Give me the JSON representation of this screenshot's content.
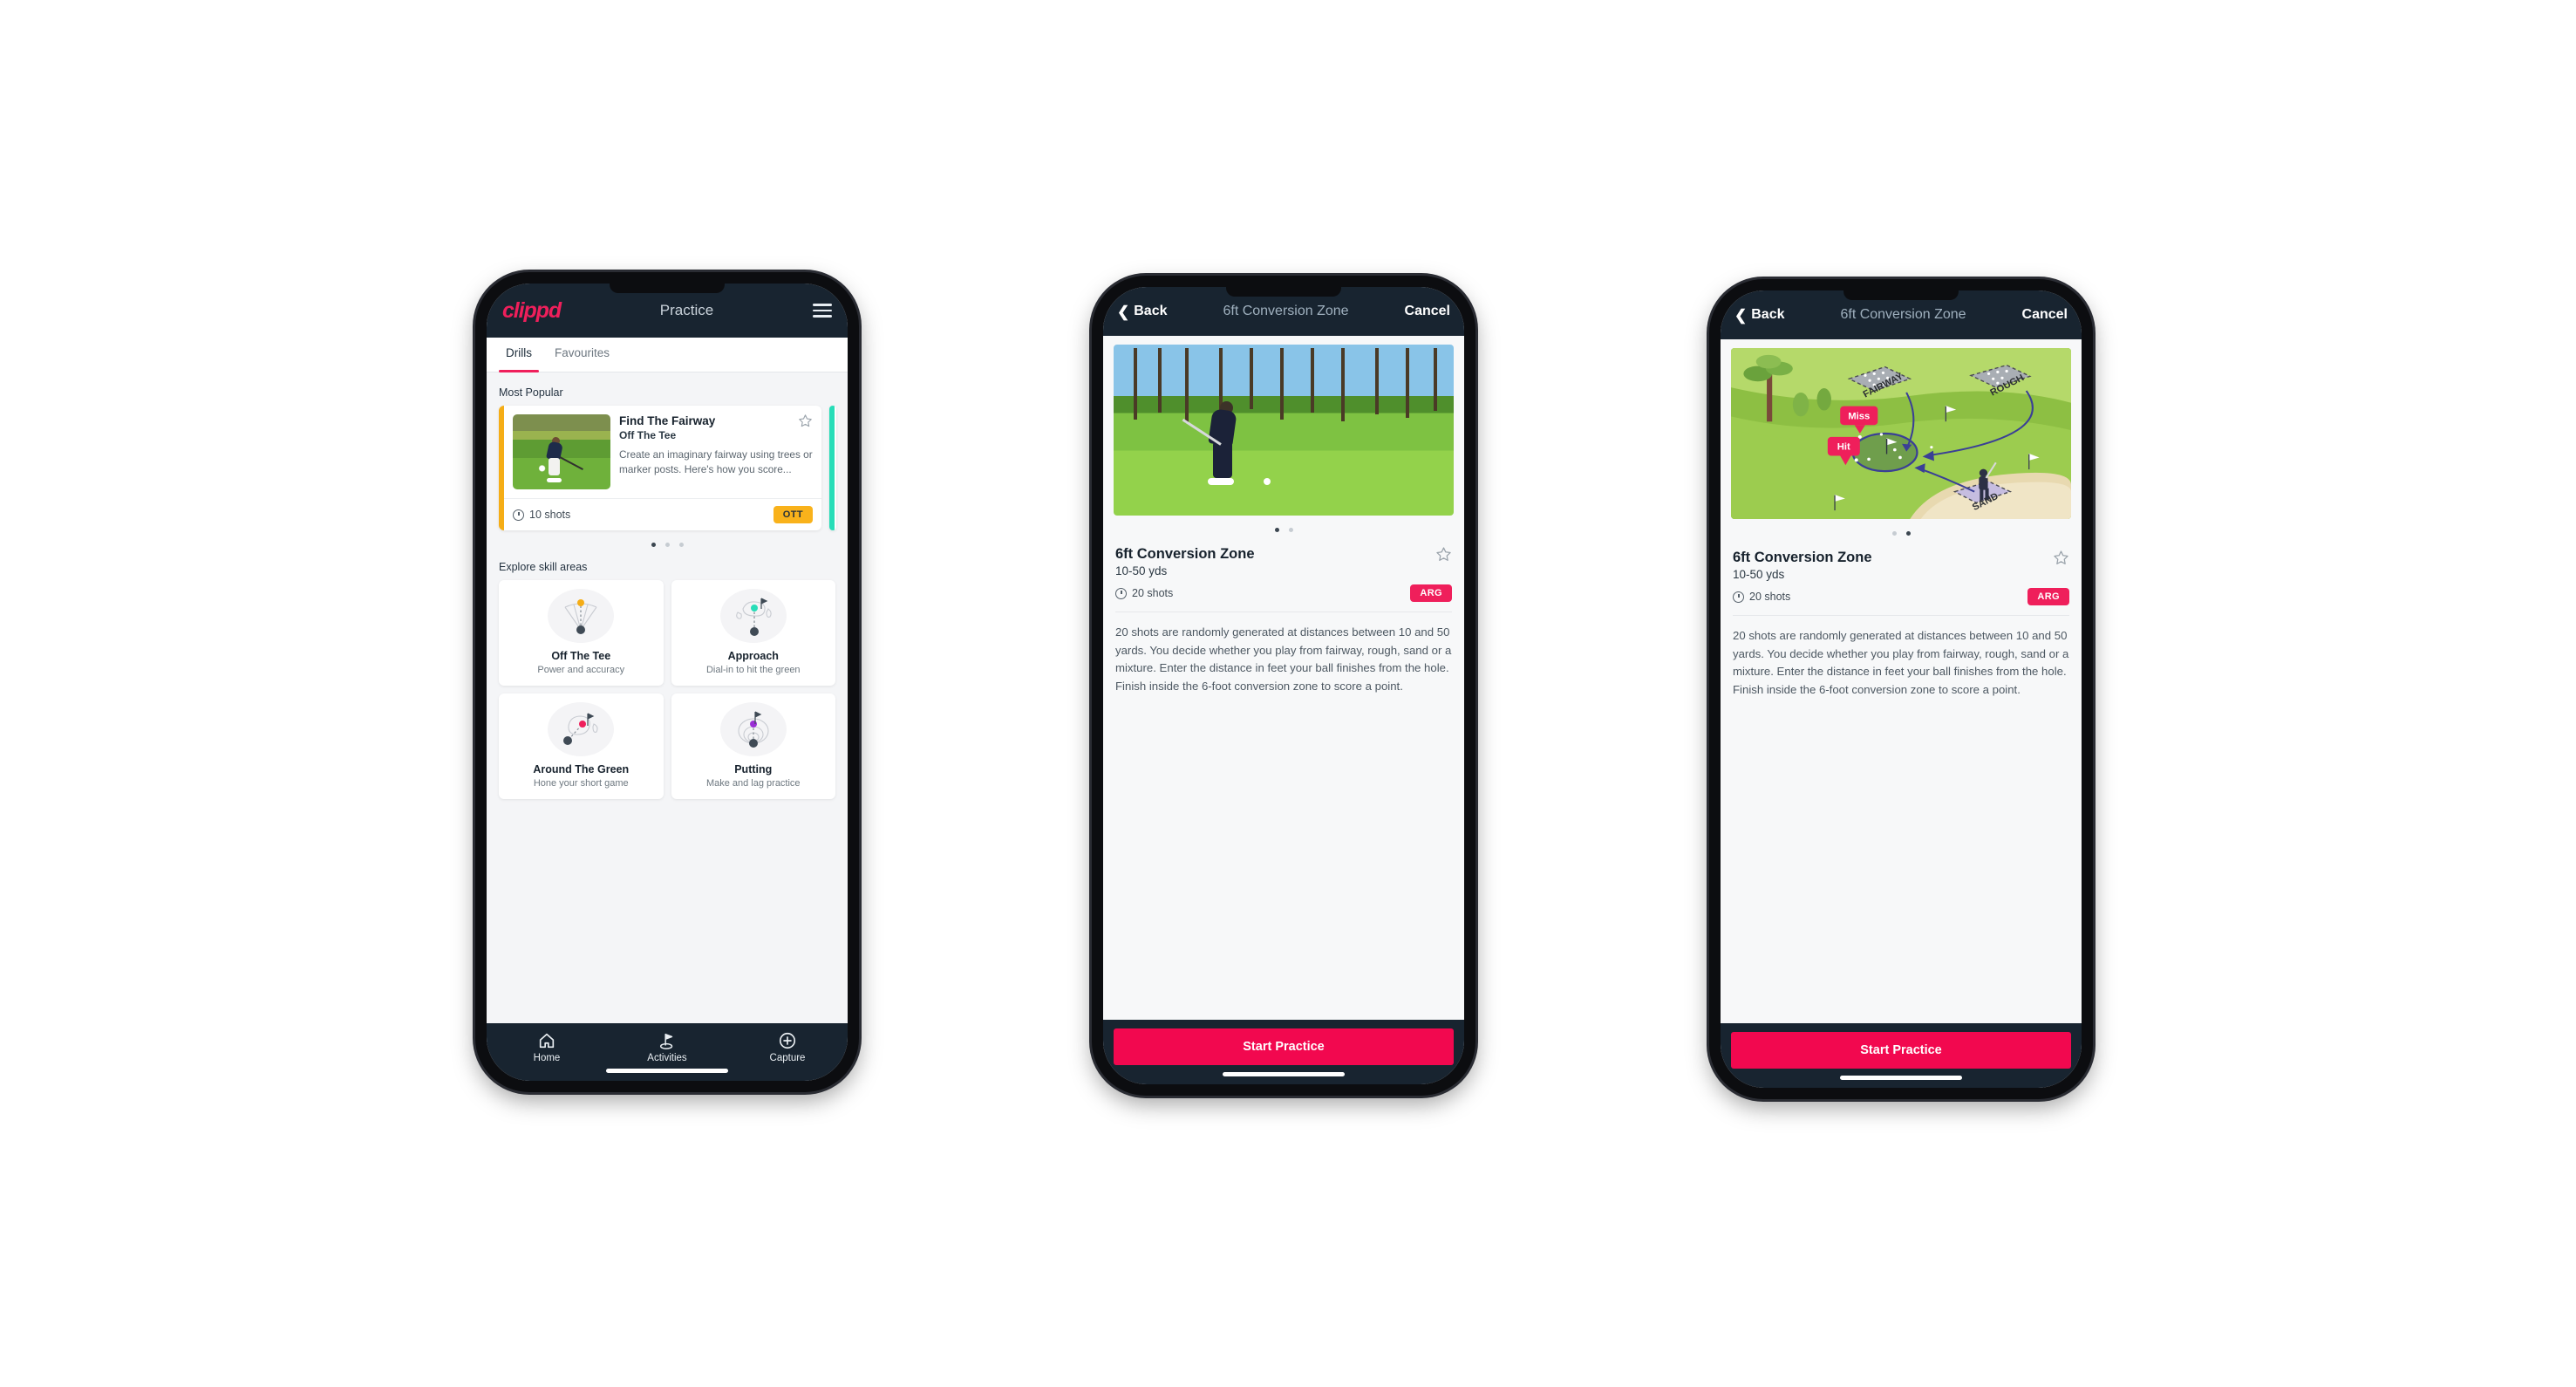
{
  "phone1": {
    "appbar": {
      "logo": "clippd",
      "title": "Practice",
      "menu_icon": "hamburger-menu-icon"
    },
    "tabs": [
      {
        "label": "Drills",
        "active": true
      },
      {
        "label": "Favourites",
        "active": false
      }
    ],
    "sections": {
      "most_popular": "Most Popular",
      "explore": "Explore skill areas"
    },
    "drill_card": {
      "title": "Find The Fairway",
      "subtitle": "Off The Tee",
      "description": "Create an imaginary fairway using trees or marker posts. Here's how you score...",
      "shots": "10 shots",
      "badge": "OTT",
      "badge_color": "#f9b21b",
      "accent_color": "#f5ad16",
      "next_accent_color": "#27ddb8",
      "star_icon": "star-outline-icon",
      "clock_icon": "clock-icon"
    },
    "carousel_dots": {
      "count": 3,
      "active": 0
    },
    "skill_areas": [
      {
        "name": "Off The Tee",
        "desc": "Power and accuracy",
        "icon": "tee-shot-fan-icon",
        "dot_color": "#f5ad16"
      },
      {
        "name": "Approach",
        "desc": "Dial-in to hit the green",
        "icon": "approach-green-icon",
        "dot_color": "#27ddb8"
      },
      {
        "name": "Around The Green",
        "desc": "Hone your short game",
        "icon": "chip-green-icon",
        "dot_color": "#ef1f5b"
      },
      {
        "name": "Putting",
        "desc": "Make and lag practice",
        "icon": "putting-rings-icon",
        "dot_color": "#9b2fd6"
      }
    ],
    "bottom_nav": [
      {
        "label": "Home",
        "icon": "home-icon",
        "active": false
      },
      {
        "label": "Activities",
        "icon": "golf-flag-icon",
        "active": true
      },
      {
        "label": "Capture",
        "icon": "plus-circle-icon",
        "active": false
      }
    ]
  },
  "phone2": {
    "nav": {
      "back": "Back",
      "title": "6ft Conversion Zone",
      "cancel": "Cancel",
      "back_icon": "chevron-left-icon"
    },
    "media": {
      "type": "photo",
      "alt": "golfer-chipping-on-course"
    },
    "carousel_dots": {
      "count": 2,
      "active": 0
    },
    "detail": {
      "title": "6ft Conversion Zone",
      "subtitle": "10-50 yds",
      "shots": "20 shots",
      "badge": "ARG",
      "badge_color": "#ef1f5b",
      "star_icon": "star-outline-icon",
      "clock_icon": "clock-icon",
      "description": "20 shots are randomly generated at distances between 10 and 50 yards. You decide whether you play from fairway, rough, sand or a mixture. Enter the distance in feet your ball finishes from the hole. Finish inside the 6-foot conversion zone to score a point."
    },
    "cta": "Start Practice",
    "cta_color": "#f2084f"
  },
  "phone3": {
    "nav": {
      "back": "Back",
      "title": "6ft Conversion Zone",
      "cancel": "Cancel",
      "back_icon": "chevron-left-icon"
    },
    "media": {
      "type": "illustration",
      "alt": "golf-hole-diagram",
      "labels": [
        "FAIRWAY",
        "ROUGH",
        "SAND"
      ],
      "markers": [
        "Miss",
        "Hit"
      ],
      "marker_color": "#ef1f5b"
    },
    "carousel_dots": {
      "count": 2,
      "active": 1
    },
    "detail": {
      "title": "6ft Conversion Zone",
      "subtitle": "10-50 yds",
      "shots": "20 shots",
      "badge": "ARG",
      "badge_color": "#ef1f5b",
      "star_icon": "star-outline-icon",
      "clock_icon": "clock-icon",
      "description": "20 shots are randomly generated at distances between 10 and 50 yards. You decide whether you play from fairway, rough, sand or a mixture. Enter the distance in feet your ball finishes from the hole. Finish inside the 6-foot conversion zone to score a point."
    },
    "cta": "Start Practice",
    "cta_color": "#f2084f"
  }
}
